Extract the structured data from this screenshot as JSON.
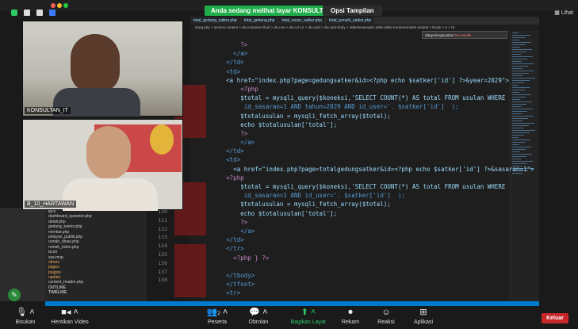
{
  "banner": {
    "sharing_text": "Anda sedang melihat layar KONSULTAN_IT",
    "options_label": "Opsi Tampilan"
  },
  "top_right": {
    "view_label": "Lihat"
  },
  "editor": {
    "tabs": [
      "total_gedung_satker.php",
      "total_gedung.php",
      "total_rusun_satker.php",
      "total_penuhi_satker.php"
    ],
    "breadcrumb": "dung.php > section.content > div.container-fluid > div.row > div.col-12 > div.card > div.card-body > table#example1.table.table-bordered.table-striped > tbody > tr > td",
    "find_label": "No results",
    "find_value": "id&gedung&satker",
    "lines": [
      {
        "text": "              ?>"
      },
      {
        "text": "            </a>"
      },
      {
        "text": "          </td>"
      },
      {
        "text": "          <td>"
      },
      {
        "text": "          <a href=\"index.php?page=gedungsatker&id=<?php echo $satker['id'] ?>&year=2029\">"
      },
      {
        "text": "              <?php"
      },
      {
        "text": "              $total = mysqli_query($koneksi,'SELECT COUNT(*) AS total FROM usulan WHERE"
      },
      {
        "text": "               id_sasaran=1 AND tahun=2029 AND id_user='. $satker['id']  );"
      },
      {
        "text": "              $totalusulan = mysqli_fetch_array($total);"
      },
      {
        "text": "              echo $totalusulan['total'];"
      },
      {
        "text": "              ?>"
      },
      {
        "text": "              </a>"
      },
      {
        "text": "          </td>"
      },
      {
        "text": "          <td>"
      },
      {
        "text": "            <a href=\"index.php?page=totalgedungsatker&id=<?php echo $satker['id'] ?>&sasaran=1\">"
      },
      {
        "text": "          <?php"
      },
      {
        "text": "              $total = mysqli_query($koneksi,'SELECT COUNT(*) AS total FROM usulan WHERE"
      },
      {
        "text": "               id_sasaran=1 AND id_user='. $satker['id']  );"
      },
      {
        "text": "              $totalusulan = mysqli_fetch_array($total);"
      },
      {
        "text": "              echo $totalusulan['total'];"
      },
      {
        "text": "              ?>"
      },
      {
        "text": "              </a>"
      },
      {
        "text": "          </td>"
      },
      {
        "text": "          </tr>"
      },
      {
        "text": "            <?php } ?>"
      },
      {
        "text": ""
      },
      {
        "text": "          </tbody>"
      },
      {
        "text": "          </tfoot>"
      },
      {
        "text": "          <tr>"
      }
    ],
    "line_numbers": [
      "130",
      "131",
      "132",
      "133",
      "134",
      "135",
      "136",
      "137",
      "138"
    ],
    "status": "Ln 141, Col 108 (46 selected)   Spaces: 4   UTF-8   LF   PHP   Go Live   Prettier"
  },
  "file_tree": [
    "tpcs",
    "dashboard_operator.php",
    "detail.php",
    "gedung_kantor.php",
    "menkar.php",
    "pelayan_publik.php",
    "rumah_dinas.php",
    "rumah_kskm.php",
    "ta.txt",
    "ssa.mvp",
    "others",
    "pages",
    "plugins",
    "update",
    "content_header.php"
  ],
  "tree_sections": [
    "OUTLINE",
    "TIMELINE"
  ],
  "videos": [
    {
      "name": "KONSULTAN_IT"
    },
    {
      "name": "B_10_HARTAWAN"
    }
  ],
  "toolbar": {
    "mute": "Bisukan",
    "video": "Hentikan Video",
    "participants": "Peserta",
    "participants_count": "2",
    "chat": "Obrolan",
    "share": "Bagikan Layar",
    "record": "Rekam",
    "reactions": "Reaksi",
    "apps": "Aplikasi",
    "leave": "Keluar"
  },
  "colors": {
    "banner_green": "#1fae4a",
    "leave_red": "#c8272a",
    "share_green": "#2ec866"
  }
}
